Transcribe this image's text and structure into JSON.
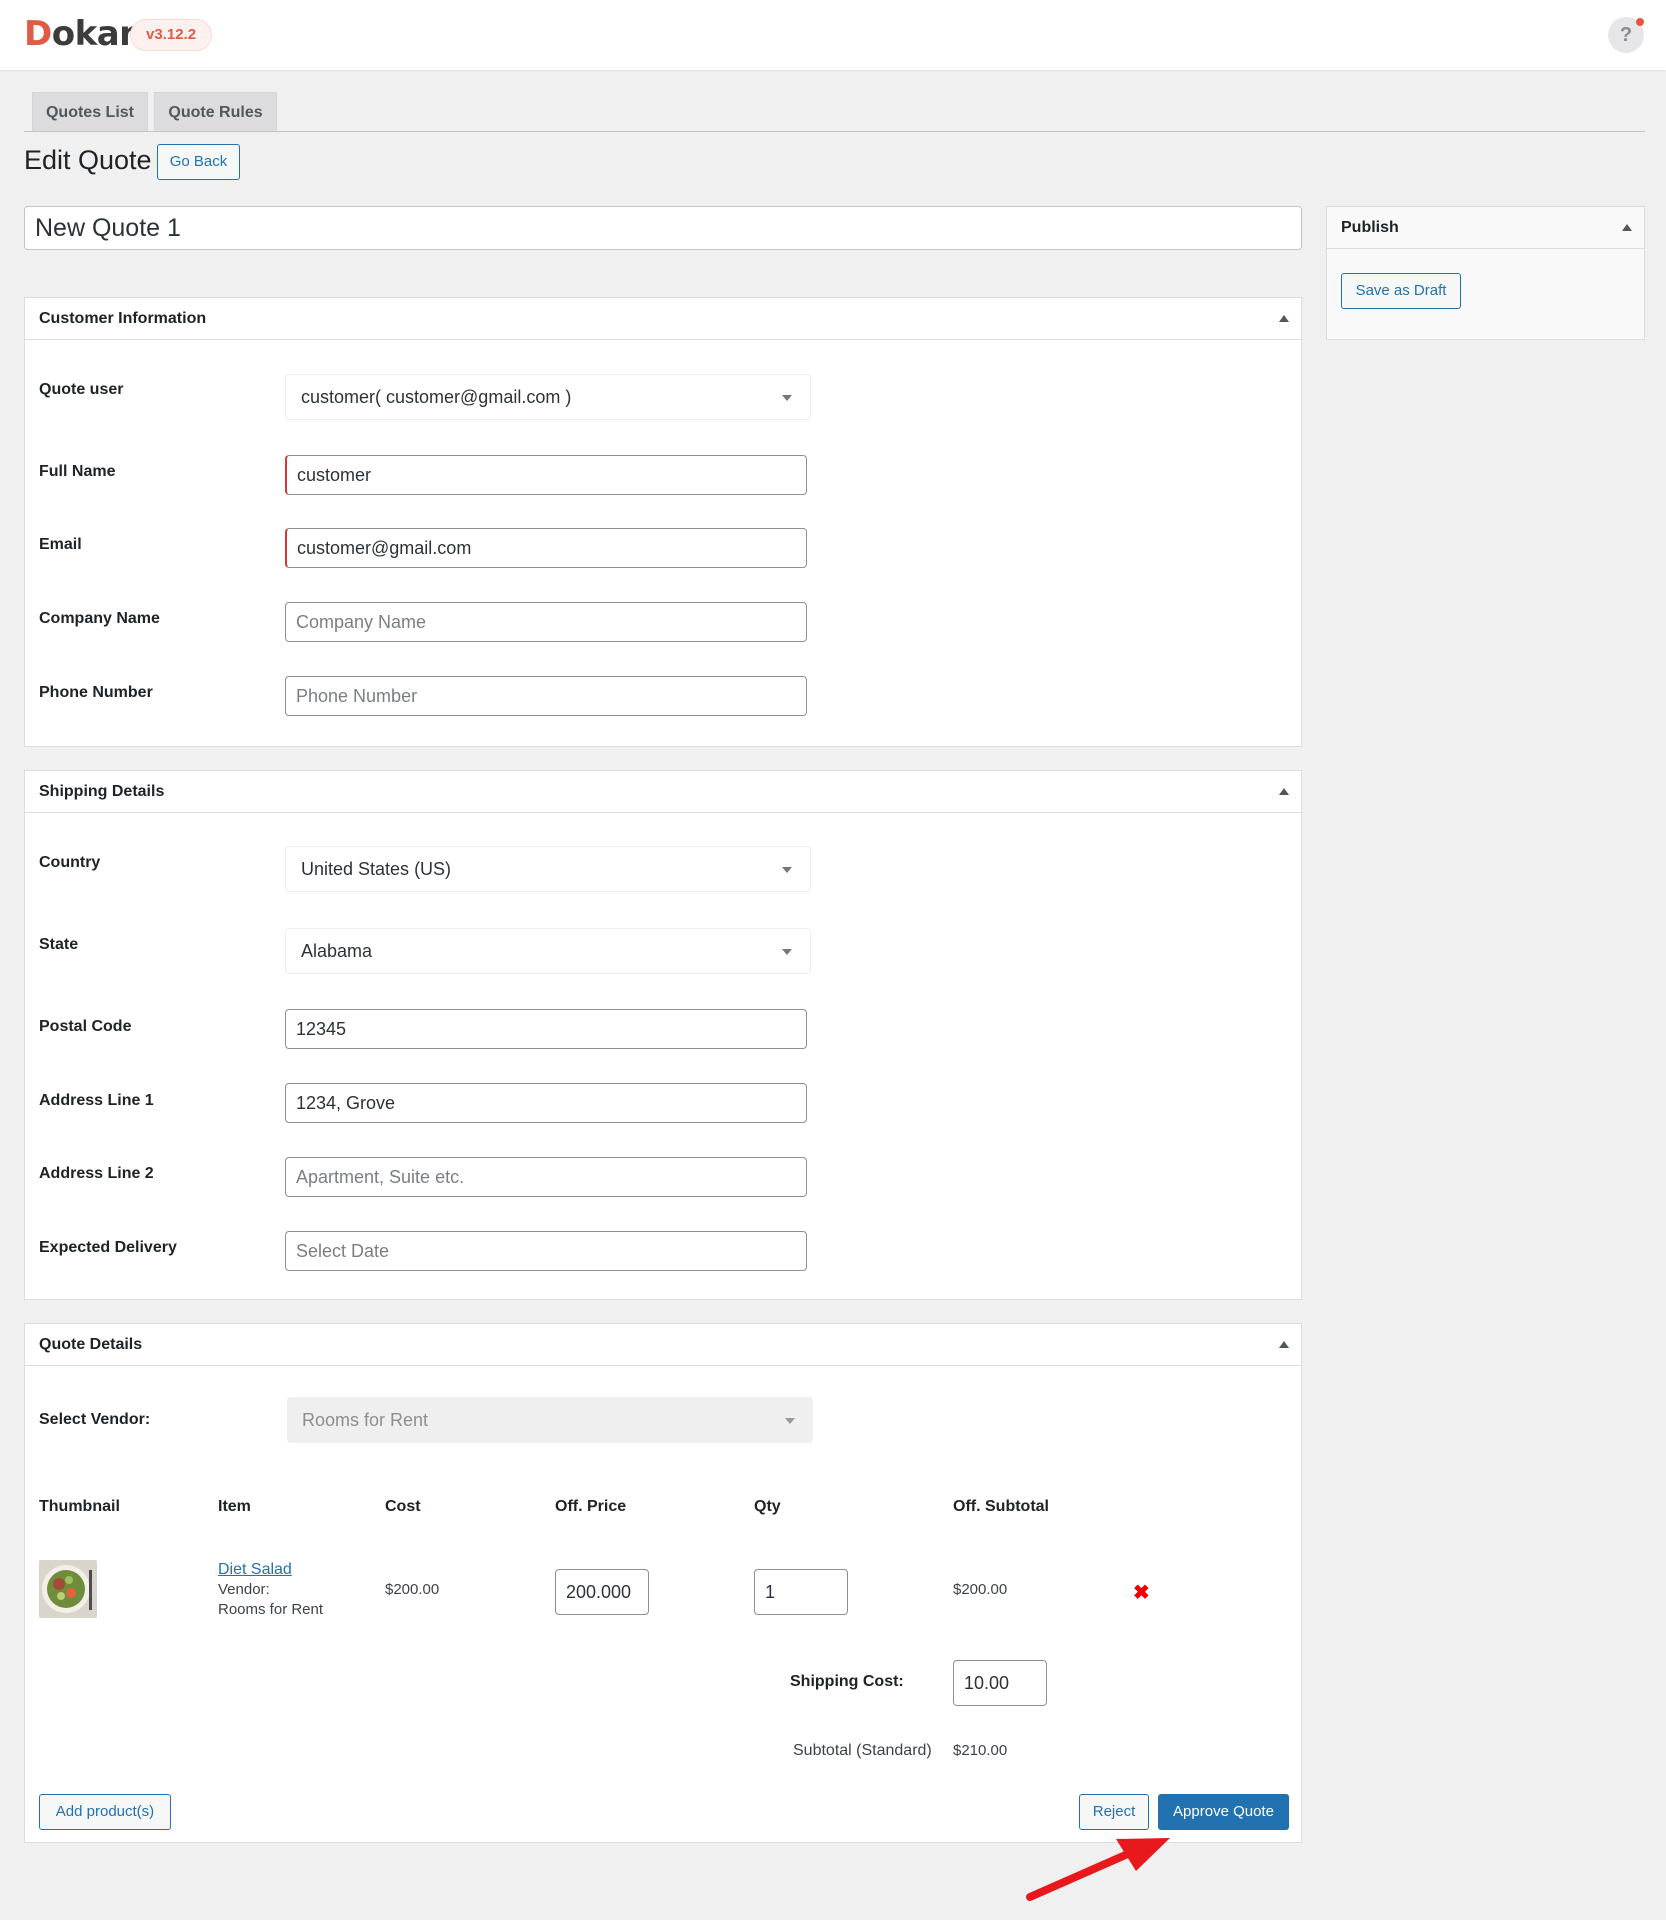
{
  "header": {
    "logo_initial": "D",
    "logo_rest": "okan",
    "version": "v3.12.2",
    "help_icon": "?"
  },
  "tabs": [
    {
      "label": "Quotes List"
    },
    {
      "label": "Quote Rules"
    }
  ],
  "page": {
    "title": "Edit Quote",
    "go_back": "Go Back",
    "quote_title": "New Quote 1"
  },
  "publish": {
    "heading": "Publish",
    "save_draft": "Save as Draft"
  },
  "customer": {
    "heading": "Customer Information",
    "quote_user_label": "Quote user",
    "quote_user_value": "customer( customer@gmail.com )",
    "full_name_label": "Full Name",
    "full_name_value": "customer",
    "email_label": "Email",
    "email_value": "customer@gmail.com",
    "company_label": "Company Name",
    "company_placeholder": "Company Name",
    "phone_label": "Phone Number",
    "phone_placeholder": "Phone Number"
  },
  "shipping": {
    "heading": "Shipping Details",
    "country_label": "Country",
    "country_value": "United States (US)",
    "state_label": "State",
    "state_value": "Alabama",
    "postal_label": "Postal Code",
    "postal_value": "12345",
    "address1_label": "Address Line 1",
    "address1_value": "1234, Grove",
    "address2_label": "Address Line 2",
    "address2_placeholder": "Apartment, Suite etc.",
    "delivery_label": "Expected Delivery",
    "delivery_placeholder": "Select Date"
  },
  "quote": {
    "heading": "Quote Details",
    "vendor_label": "Select Vendor:",
    "vendor_value": "Rooms for Rent",
    "columns": [
      "Thumbnail",
      "Item",
      "Cost",
      "Off. Price",
      "Qty",
      "Off. Subtotal"
    ],
    "items": [
      {
        "name": "Diet Salad",
        "vendor_label": "Vendor:",
        "vendor": "Rooms for Rent",
        "cost": "$200.00",
        "offer_price": "200.000",
        "qty": "1",
        "offer_subtotal": "$200.00",
        "remove_icon": "✖"
      }
    ],
    "shipping_cost_label": "Shipping Cost:",
    "shipping_cost_value": "10.00",
    "subtotal_label": "Subtotal (Standard)",
    "subtotal_value": "$210.00",
    "add_products": "Add product(s)",
    "reject": "Reject",
    "approve": "Approve Quote"
  },
  "colors": {
    "brand": "#e25a44",
    "primary": "#2271b1",
    "danger": "#d63638",
    "annotation_arrow": "#e8191c"
  }
}
